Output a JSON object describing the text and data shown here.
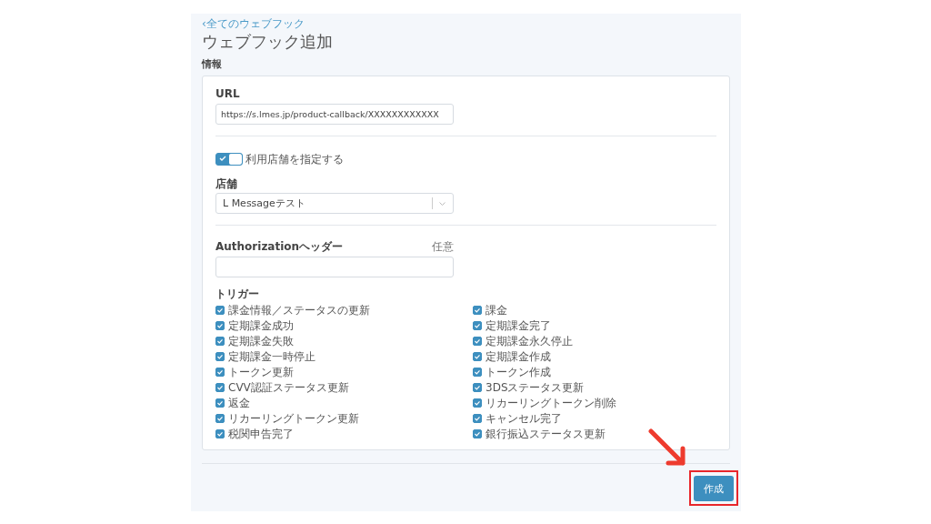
{
  "back_link": "‹全てのウェブフック",
  "title": "ウェブフック追加",
  "section": "情報",
  "url": {
    "label": "URL",
    "value": "https://s.lmes.jp/product-callback/XXXXXXXXXXXX"
  },
  "store_toggle": {
    "label": "利用店舗を指定する",
    "on": true
  },
  "store": {
    "label": "店舗",
    "value": "L Messageテスト"
  },
  "authorization": {
    "label": "Authorizationヘッダー",
    "note": "任意"
  },
  "triggers_label": "トリガー",
  "triggers": [
    {
      "label": "課金情報／ステータスの更新",
      "checked": true
    },
    {
      "label": "課金",
      "checked": true
    },
    {
      "label": "定期課金成功",
      "checked": true
    },
    {
      "label": "定期課金完了",
      "checked": true
    },
    {
      "label": "定期課金失敗",
      "checked": true
    },
    {
      "label": "定期課金永久停止",
      "checked": true
    },
    {
      "label": "定期課金一時停止",
      "checked": true
    },
    {
      "label": "定期課金作成",
      "checked": true
    },
    {
      "label": "トークン更新",
      "checked": true
    },
    {
      "label": "トークン作成",
      "checked": true
    },
    {
      "label": "CVV認証ステータス更新",
      "checked": true
    },
    {
      "label": "3DSステータス更新",
      "checked": true
    },
    {
      "label": "返金",
      "checked": true
    },
    {
      "label": "リカーリングトークン削除",
      "checked": true
    },
    {
      "label": "リカーリングトークン更新",
      "checked": true
    },
    {
      "label": "キャンセル完了",
      "checked": true
    },
    {
      "label": "税関申告完了",
      "checked": true
    },
    {
      "label": "銀行振込ステータス更新",
      "checked": true
    }
  ],
  "submit": "作成"
}
